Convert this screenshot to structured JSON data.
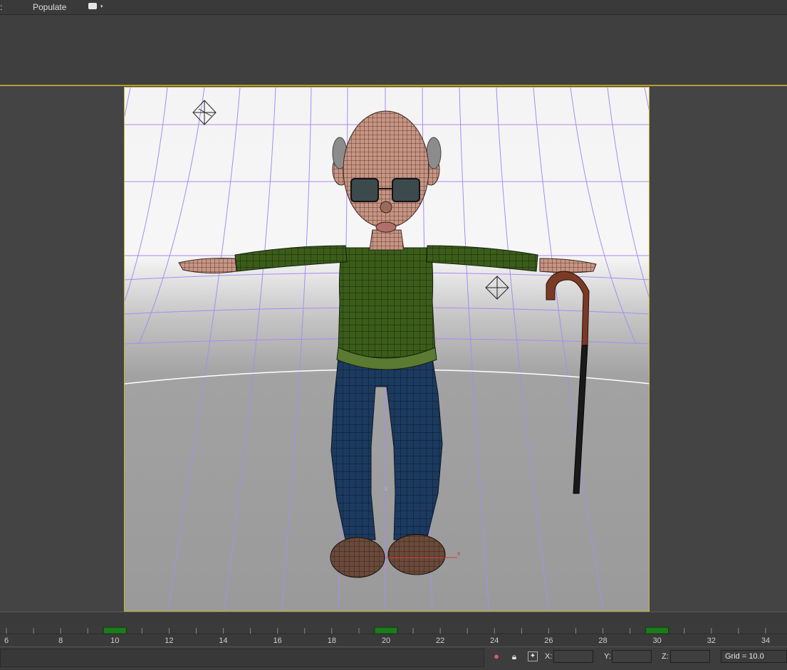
{
  "menubar": {
    "cut_item": ":",
    "populate": "Populate",
    "dropdown_arrow": "▾"
  },
  "timeline": {
    "ticks": [
      "6",
      "8",
      "10",
      "12",
      "14",
      "16",
      "18",
      "20",
      "22",
      "24",
      "26",
      "28",
      "30",
      "32",
      "34"
    ],
    "key_frames": [
      10,
      20,
      30
    ]
  },
  "status": {
    "x_label": "X:",
    "y_label": "Y:",
    "z_label": "Z:",
    "x_value": "",
    "y_value": "",
    "z_value": "",
    "grid": "Grid = 10.0"
  },
  "viewport": {
    "axis_x": "x",
    "axis_z": "z",
    "colors": {
      "border": "#c9b83a",
      "grid": "#a78cf0",
      "sweater": "#3d5e1c",
      "jeans": "#1c3b63",
      "skin": "#c79884",
      "cane": "#7a3a25"
    }
  },
  "icons": {
    "pin": "pin-icon",
    "lock": "lock-icon",
    "snap": "snap-toggle-icon",
    "light_helper": "light-helper-icon"
  }
}
